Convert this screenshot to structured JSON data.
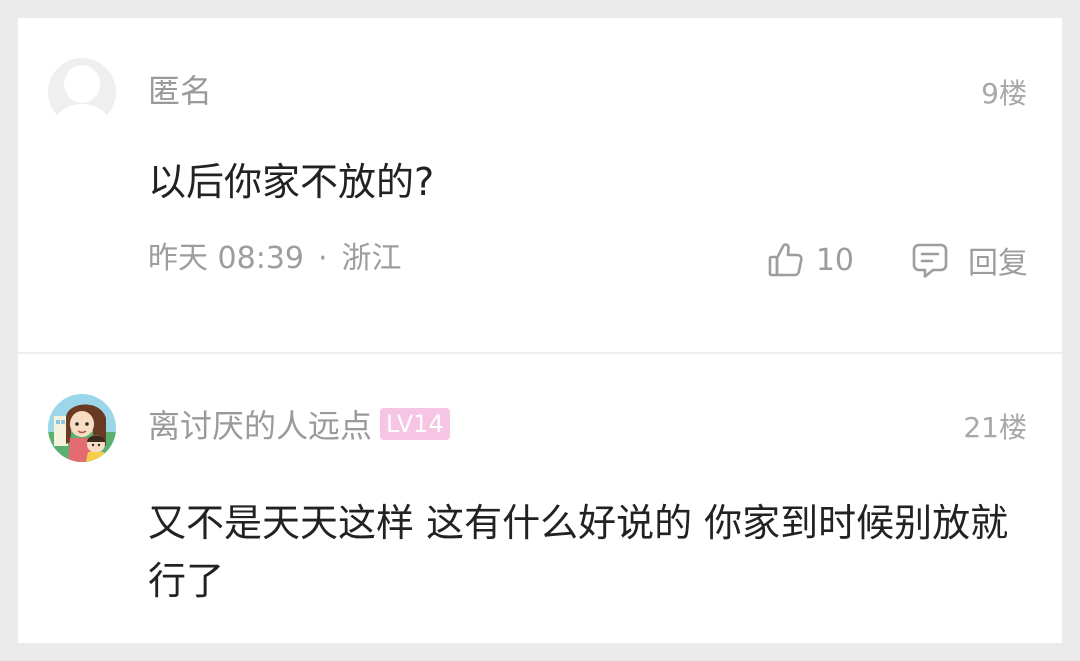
{
  "comments": [
    {
      "username": "匿名",
      "avatar_icon": "anonymous-user-icon",
      "floor": "9楼",
      "content": "以后你家不放的?",
      "time": "昨天 08:39",
      "separator": "·",
      "location": "浙江",
      "like_icon": "thumbs-up-icon",
      "likes": "10",
      "reply_icon": "comment-bubble-icon",
      "reply_label": "回复"
    },
    {
      "username": "离讨厌的人远点",
      "avatar_icon": "cartoon-avatar",
      "level_badge": "LV14",
      "level_badge_color": "#f6c5e3",
      "floor": "21楼",
      "content": "又不是天天这样 这有什么好说的 你家到时候别放就行了"
    }
  ]
}
